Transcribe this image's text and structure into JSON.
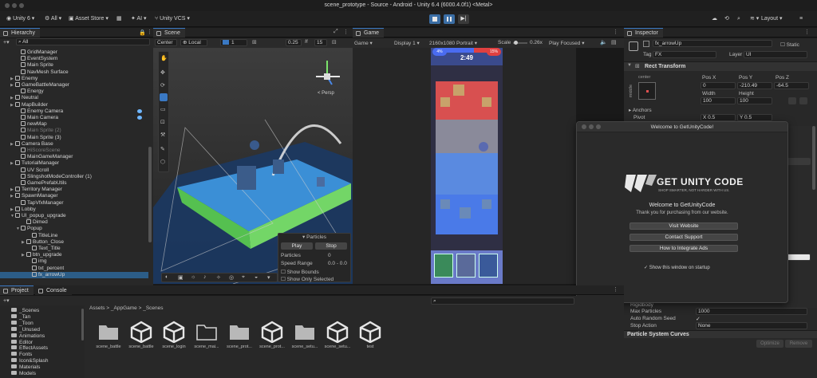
{
  "window_title": "scene_prototype - Source - Android - Unity 6.4 (6000.4.0f1) <Metal>",
  "toolbar": {
    "account": "Unity 6",
    "all": "All",
    "asset_store": "Asset Store",
    "ai": "AI",
    "vcs": "Unity VCS",
    "layout": "Layout"
  },
  "hierarchy": {
    "tab": "Hierarchy",
    "search_placeholder": "All",
    "items": [
      {
        "label": "GridManager",
        "indent": 2,
        "arrow": ""
      },
      {
        "label": "EventSystem",
        "indent": 2,
        "arrow": ""
      },
      {
        "label": "Main Sprite",
        "indent": 2,
        "arrow": ""
      },
      {
        "label": "NavMesh Surface",
        "indent": 2,
        "arrow": ""
      },
      {
        "label": "Enemy",
        "indent": 1,
        "arrow": "▶"
      },
      {
        "label": "GameBattleManager",
        "indent": 1,
        "arrow": "▶"
      },
      {
        "label": "Energy",
        "indent": 2,
        "arrow": ""
      },
      {
        "label": "Neutral",
        "indent": 1,
        "arrow": "▶"
      },
      {
        "label": "MapBuilder",
        "indent": 1,
        "arrow": "▶"
      },
      {
        "label": "Enemy Camera",
        "indent": 2,
        "arrow": ""
      },
      {
        "label": "Main Camera",
        "indent": 2,
        "arrow": ""
      },
      {
        "label": "newMap",
        "indent": 2,
        "arrow": ""
      },
      {
        "label": "Main Sprite (2)",
        "indent": 2,
        "arrow": "",
        "dim": true
      },
      {
        "label": "Main Sprite (3)",
        "indent": 2,
        "arrow": ""
      },
      {
        "label": "Camera Base",
        "indent": 1,
        "arrow": "▶"
      },
      {
        "label": "HiScoreScene",
        "indent": 2,
        "arrow": "",
        "dim": true
      },
      {
        "label": "MainGameManager",
        "indent": 2,
        "arrow": ""
      },
      {
        "label": "TutorialManager",
        "indent": 1,
        "arrow": "▶"
      },
      {
        "label": "UV Scroll",
        "indent": 2,
        "arrow": ""
      },
      {
        "label": "SlingshotModeController (1)",
        "indent": 2,
        "arrow": ""
      },
      {
        "label": "GamePrefabUtils",
        "indent": 2,
        "arrow": ""
      },
      {
        "label": "Territory Manager",
        "indent": 1,
        "arrow": "▶"
      },
      {
        "label": "SpawnManager",
        "indent": 1,
        "arrow": "▶"
      },
      {
        "label": "TapVfxManager",
        "indent": 2,
        "arrow": ""
      },
      {
        "label": "Lobby",
        "indent": 1,
        "arrow": "▶"
      },
      {
        "label": "UI_popup_upgrade",
        "indent": 1,
        "arrow": "▼"
      },
      {
        "label": "Dimed",
        "indent": 3,
        "arrow": ""
      },
      {
        "label": "Popup",
        "indent": 2,
        "arrow": "▼"
      },
      {
        "label": "TitleLine",
        "indent": 4,
        "arrow": ""
      },
      {
        "label": "Button_Close",
        "indent": 3,
        "arrow": "▶"
      },
      {
        "label": "Text_Title",
        "indent": 4,
        "arrow": ""
      },
      {
        "label": "btn_upgrade",
        "indent": 3,
        "arrow": "▶"
      },
      {
        "label": "img",
        "indent": 4,
        "arrow": ""
      },
      {
        "label": "txt_percent",
        "indent": 4,
        "arrow": ""
      },
      {
        "label": "fx_arrowUp",
        "indent": 4,
        "arrow": "",
        "selected": true
      }
    ]
  },
  "scene": {
    "tab": "Scene",
    "pivot": "Center",
    "space": "Local",
    "layer": "1",
    "snap": "0.25",
    "grid": "15",
    "persp": "< Persp",
    "particles": {
      "title": "Particles",
      "play": "Play",
      "stop": "Stop",
      "rows": [
        {
          "label": "Particles",
          "value": "0"
        },
        {
          "label": "Speed Range",
          "value": "0.0 - 0.0"
        }
      ],
      "show_bounds": "Show Bounds",
      "show_only_selected": "Show Only Selected"
    }
  },
  "game": {
    "tab": "Game",
    "mode": "Game",
    "display": "Display 1",
    "resolution": "2160x1080 Portrait",
    "scale_label": "Scale",
    "scale": "0.26x",
    "play_focused": "Play Focused",
    "timer": "2:49",
    "left_score": "4%",
    "right_score": "15%"
  },
  "inspector": {
    "tab": "Inspector",
    "object_name": "fx_arrowUp",
    "static": "Static",
    "tag_label": "Tag",
    "tag": "FX",
    "layer_label": "Layer",
    "layer": "UI",
    "component": "Rect Transform",
    "anchor_label": "center",
    "middle_label": "middle",
    "pos_x_label": "Pos X",
    "pos_y_label": "Pos Y",
    "pos_z_label": "Pos Z",
    "pos_x": "0",
    "pos_y": "-210.49",
    "pos_z": "-64.5",
    "width_label": "Width",
    "height_label": "Height",
    "width": "100",
    "height": "100",
    "anchors": "Anchors",
    "pivot_label": "Pivot",
    "pivot_x": "X 0.5",
    "pivot_y": "Y 0.5",
    "max_particles_label": "Max Particles",
    "max_particles": "1000",
    "auto_seed_label": "Auto Random Seed",
    "stop_action_label": "Stop Action",
    "stop_action": "None",
    "rigidbody_label": "Rigidbody",
    "curves": "Particle System Curves",
    "optimize": "Optimize",
    "remove": "Remove"
  },
  "dialog": {
    "title": "Welcome to GetUnityCode!",
    "brand": "GET UNITY CODE",
    "tagline": "SHOP SMARTER, NOT HARDER WITH US.",
    "welcome": "Welcome to GetUnityCode",
    "thanks": "Thank you for purchasing from our website.",
    "btn_website": "Visit Website",
    "btn_support": "Contact Support",
    "btn_ads": "How to Integrate Ads",
    "startup": "Show this window on startup"
  },
  "project": {
    "tab_project": "Project",
    "tab_console": "Console",
    "breadcrumb": "Assets > _AppGame > _Scenes",
    "folders": [
      "_Scenes",
      "_Tan",
      "_Toon",
      "_Unused",
      "Animations",
      "Editor",
      "EffectAssets",
      "Fonts",
      "Icon&Splash",
      "Materials",
      "Models"
    ],
    "assets": [
      {
        "label": "scene_battle",
        "type": "folder"
      },
      {
        "label": "scene_battle",
        "type": "unity"
      },
      {
        "label": "scene_login",
        "type": "unity"
      },
      {
        "label": "scene_mai...",
        "type": "folder-outline"
      },
      {
        "label": "scene_prot...",
        "type": "folder"
      },
      {
        "label": "scene_prot...",
        "type": "unity"
      },
      {
        "label": "scene_setu...",
        "type": "folder"
      },
      {
        "label": "scene_setu...",
        "type": "unity"
      },
      {
        "label": "test",
        "type": "unity"
      }
    ]
  },
  "colors": {
    "accent": "#3a79c4",
    "selected": "#2c5d87",
    "playmode": "#3b6ea5"
  }
}
